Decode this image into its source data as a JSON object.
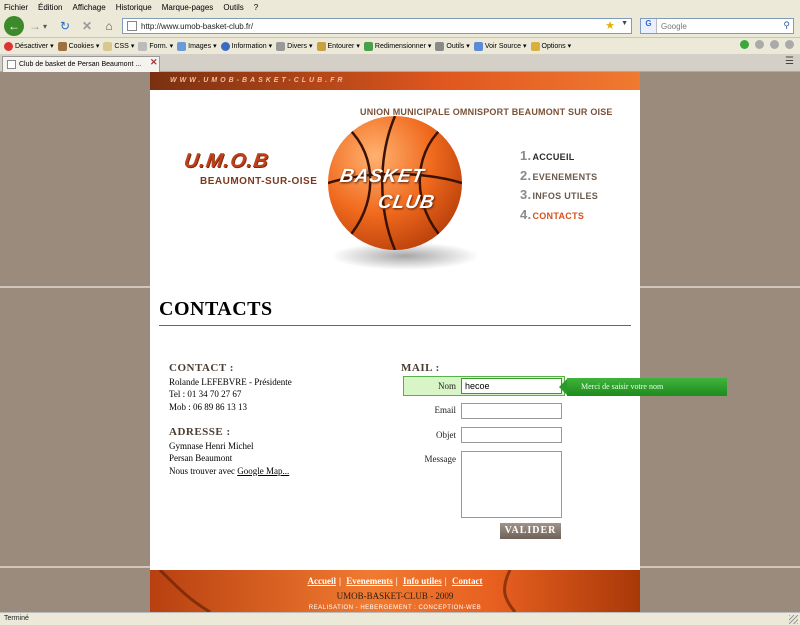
{
  "browser": {
    "menu": [
      "Fichier",
      "Édition",
      "Affichage",
      "Historique",
      "Marque-pages",
      "Outils",
      "?"
    ],
    "url": "http://www.umob-basket-club.fr/",
    "search_placeholder": "Google",
    "search_engine_label": "G",
    "toolbar": [
      "Désactiver",
      "Cookies",
      "CSS",
      "Form.",
      "Images",
      "Information",
      "Divers",
      "Entourer",
      "Redimensionner",
      "Outils",
      "Voir Source",
      "Options"
    ],
    "tab_title": "Club de basket de Persan Beaumont ...",
    "status": "Terminé"
  },
  "site": {
    "url_strip": "WWW.UMOB-BASKET-CLUB.FR",
    "union": "UNION MUNICIPALE OMNISPORT BEAUMONT SUR OISE",
    "logo_name": "U.M.O.B",
    "logo_city": "BEAUMONT-SUR-OISE",
    "ball_text_1": "BASKET",
    "ball_text_2": "CLUB",
    "nav": [
      {
        "num": "1.",
        "label": "ACCUEIL"
      },
      {
        "num": "2.",
        "label": "EVENEMENTS"
      },
      {
        "num": "3.",
        "label": "INFOS UTILES"
      },
      {
        "num": "4.",
        "label": "CONTACTS"
      }
    ]
  },
  "content": {
    "title": "CONTACTS",
    "contact_head": "CONTACT :",
    "contact_lines": [
      "Rolande LEFEBVRE - Présidente",
      "Tel : 01 34 70 27 67",
      "Mob : 06 89 86 13 13"
    ],
    "address_head": "ADRESSE :",
    "address_lines": [
      "Gymnase Henri Michel",
      "Persan Beaumont"
    ],
    "map_prefix": "Nous trouver avec",
    "map_link": "Google Map...",
    "mail_head": "MAIL :",
    "form": {
      "name_label": "Nom",
      "name_value": "hecoe",
      "email_label": "Email",
      "subject_label": "Objet",
      "message_label": "Message",
      "submit": "VALIDER",
      "tooltip": "Merci de saisir votre nom"
    }
  },
  "footer": {
    "links": [
      "Accueil",
      "Evenements",
      "Info utiles",
      "Contact"
    ],
    "copyright": "UMOB-BASKET-CLUB - 2009",
    "small": "REALISATION - HEBERGEMENT : CONCEPTION-WEB"
  }
}
